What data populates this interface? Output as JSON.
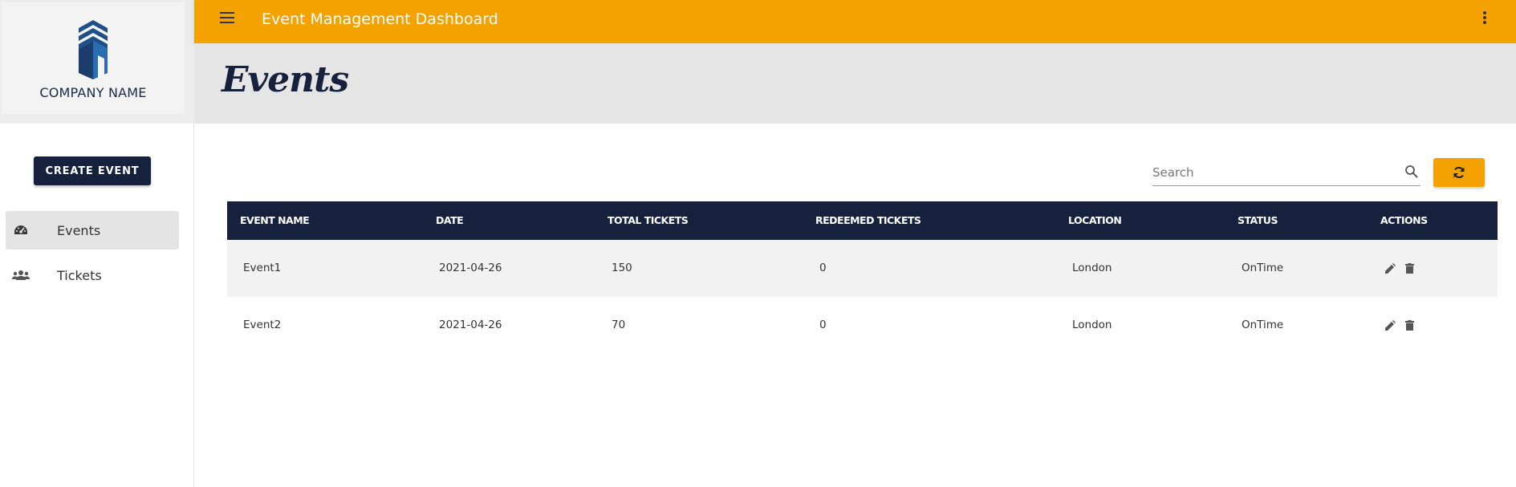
{
  "sidebar": {
    "company_name": "COMPANY NAME",
    "create_button": "CREATE EVENT",
    "items": [
      {
        "label": "Events",
        "icon": "dashboard-gauge-icon",
        "active": true
      },
      {
        "label": "Tickets",
        "icon": "users-group-icon",
        "active": false
      }
    ]
  },
  "topbar": {
    "title": "Event Management Dashboard",
    "menu_icon": "hamburger-menu-icon",
    "more_icon": "kebab-menu-icon"
  },
  "page": {
    "title": "Events"
  },
  "search": {
    "placeholder": "Search",
    "value": ""
  },
  "refresh": {
    "icon": "refresh-icon"
  },
  "table": {
    "columns": [
      "EVENT NAME",
      "DATE",
      "TOTAL TICKETS",
      "REDEEMED TICKETS",
      "LOCATION",
      "STATUS",
      "ACTIONS"
    ],
    "rows": [
      {
        "name": "Event1",
        "date": "2021-04-26",
        "total": "150",
        "redeemed": "0",
        "location": "London",
        "status": "OnTime"
      },
      {
        "name": "Event2",
        "date": "2021-04-26",
        "total": "70",
        "redeemed": "0",
        "location": "London",
        "status": "OnTime"
      }
    ]
  },
  "colors": {
    "accent": "#f4a102",
    "navy": "#16213e",
    "header_band": "#e5e5e5",
    "row_alt": "#f2f2f2"
  }
}
